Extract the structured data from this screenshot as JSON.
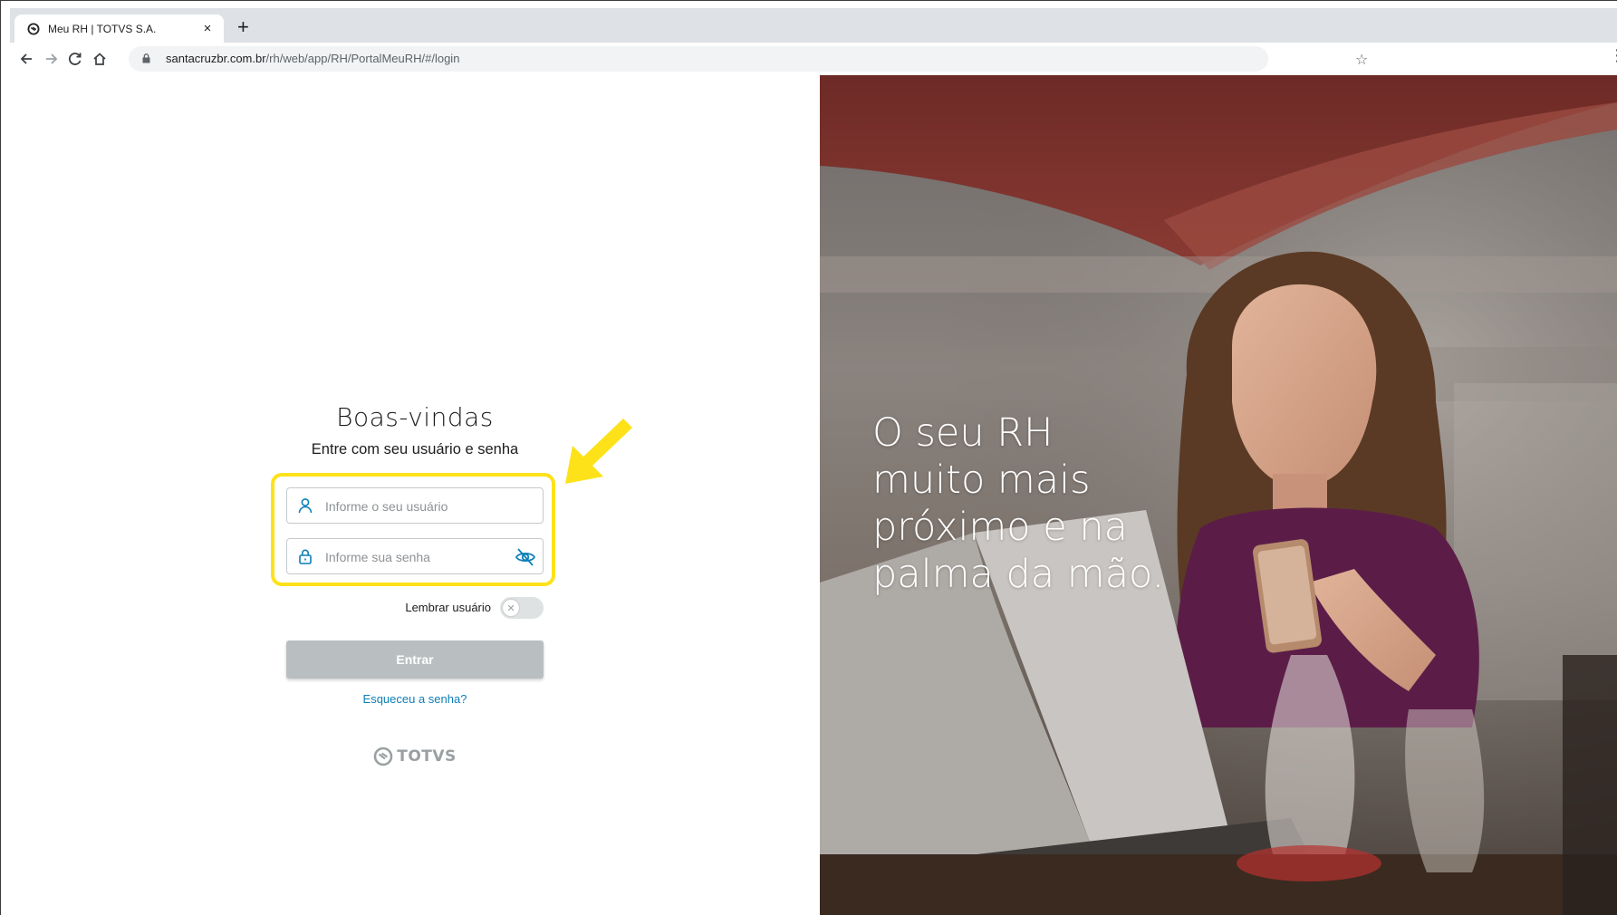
{
  "browser": {
    "tab_title": "Meu RH | TOTVS S.A.",
    "tab_close": "×",
    "new_tab": "+",
    "url_host": "santacruzbr.com.br",
    "url_path": "/rh/web/app/RH/PortalMeuRH/#/login",
    "star": "☆",
    "menu": "⋮"
  },
  "login": {
    "title": "Boas-vindas",
    "subtitle": "Entre com seu usuário e senha",
    "username_placeholder": "Informe o seu usuário",
    "password_placeholder": "Informe sua senha",
    "remember_label": "Lembrar usuário",
    "remember_checked": false,
    "toggle_knob": "✕",
    "submit_label": "Entrar",
    "forgot_label": "Esqueceu a senha?",
    "brand": "TOTVS"
  },
  "hero": {
    "lines": [
      "O seu RH",
      "muito mais",
      "próximo e na",
      "palma da mão."
    ]
  },
  "colors": {
    "highlight": "#fde21a",
    "link": "#0c7fb6",
    "accent_icon": "#0c7fb6",
    "button_disabled": "#b9bfc1"
  }
}
